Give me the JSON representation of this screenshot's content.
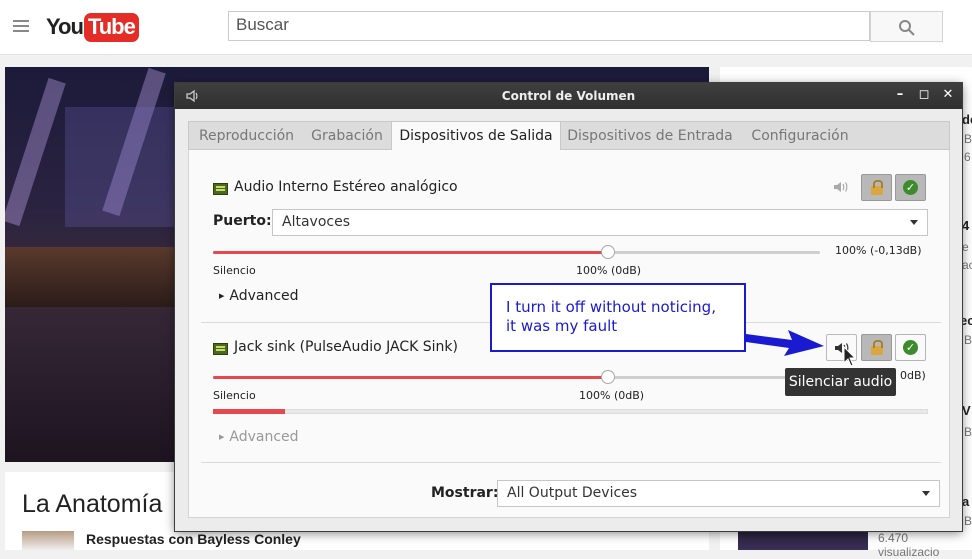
{
  "youtube": {
    "logo_you": "You",
    "logo_tube": "Tube",
    "search_placeholder": "Buscar",
    "video_title": "La Anatomía",
    "channel": "Respuestas con Bayless Conley",
    "sidebar": {
      "item1": "de",
      "item1_sub1": "B",
      "item1_sub2": "6",
      "item2": "4",
      "item2_sub1": "e",
      "item2_sub2": "ac",
      "item3": "ec",
      "item3_sub": "B",
      "item4": "V",
      "item4_sub": "B",
      "item5": "a",
      "item5_sub": "B",
      "views": "6.470 visualizacio"
    }
  },
  "window": {
    "title": "Control de Volumen",
    "tabs": [
      "Reproducción",
      "Grabación",
      "Dispositivos de Salida",
      "Dispositivos de Entrada",
      "Configuración"
    ],
    "active_tab": 2,
    "minimize": "–",
    "maximize": "◻",
    "close": "✕"
  },
  "device1": {
    "name": "Audio Interno Estéreo analógico",
    "port_label": "Puerto:",
    "port_value": "Altavoces",
    "volume_percent": 100,
    "volume_readout": "100% (-0,13dB)",
    "silence_label": "Silencio",
    "mid_label": "100% (0dB)",
    "advanced": "Advanced"
  },
  "device2": {
    "name": "Jack sink (PulseAudio JACK Sink)",
    "volume_percent": 100,
    "volume_readout_partial": "0dB)",
    "silence_label": "Silencio",
    "mid_label": "100% (0dB)",
    "meter_level": 0.1,
    "advanced": "Advanced"
  },
  "footer": {
    "show_label": "Mostrar:",
    "show_value": "All Output Devices"
  },
  "annotation": {
    "line1": "I turn it off without noticing,",
    "line2": "it was my fault"
  },
  "tooltip": "Silenciar audio",
  "colors": {
    "slider_fill": "#e5484d",
    "annotation_blue": "#1a1ad0",
    "youtube_red": "#e52d27"
  }
}
